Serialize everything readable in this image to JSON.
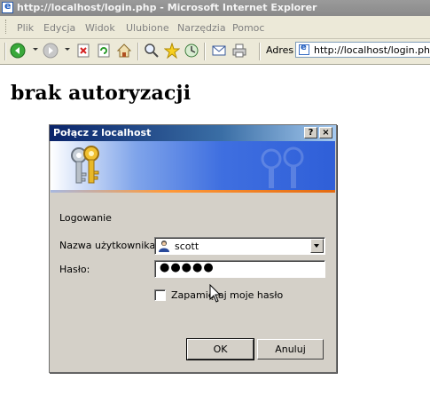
{
  "window": {
    "title": "http://localhost/login.php - Microsoft Internet Explorer"
  },
  "menu": [
    "Plik",
    "Edycja",
    "Widok",
    "Ulubione",
    "Narzędzia",
    "Pomoc"
  ],
  "toolbar": {
    "buttons": [
      "back-icon",
      "forward-icon",
      "stop-icon",
      "refresh-icon",
      "home-icon",
      "search-icon",
      "favorites-icon",
      "history-icon",
      "mail-icon",
      "print-icon"
    ],
    "address_label": "Adres",
    "url": "http://localhost/login.php"
  },
  "page": {
    "heading": "brak autoryzacji"
  },
  "dialog": {
    "title": "Połącz z localhost",
    "help_label": "?",
    "close_label": "×",
    "section_label": "Logowanie",
    "username_label": "Nazwa użytkownika:",
    "username_value": "scott",
    "password_label": "Hasło:",
    "password_value": "●●●●●",
    "remember_label": "Zapamiętaj moje hasło",
    "remember_checked": false,
    "ok_label": "OK",
    "cancel_label": "Anuluj"
  }
}
